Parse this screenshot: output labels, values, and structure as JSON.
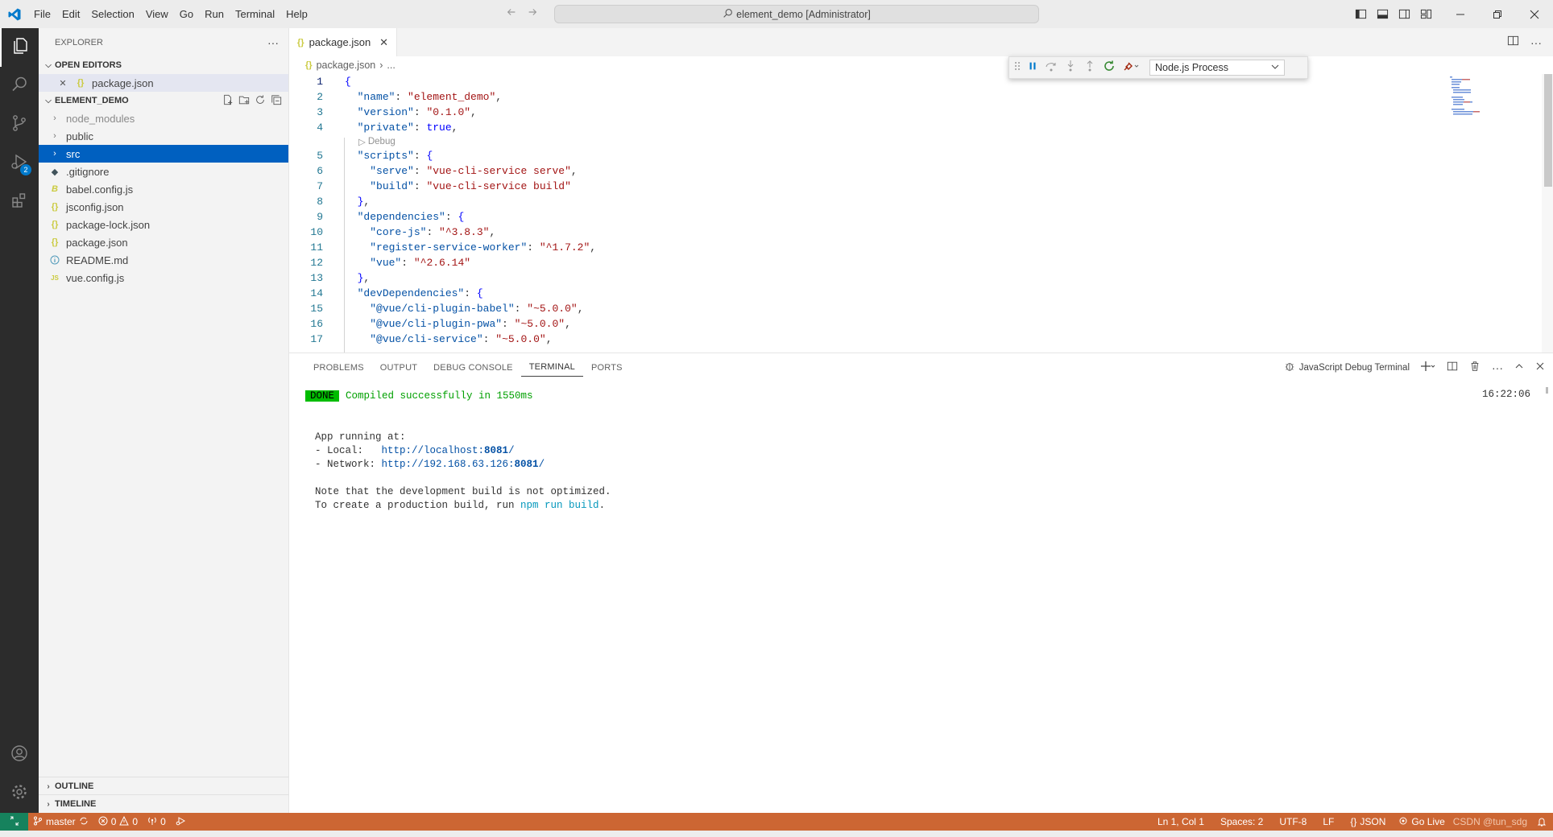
{
  "titlebar": {
    "menus": [
      "File",
      "Edit",
      "Selection",
      "View",
      "Go",
      "Run",
      "Terminal",
      "Help"
    ],
    "search_text": "element_demo [Administrator]"
  },
  "activity": {
    "debug_badge": "2"
  },
  "sidebar": {
    "header": "EXPLORER",
    "open_editors_title": "OPEN EDITORS",
    "open_editor_file": "package.json",
    "project_title": "ELEMENT_DEMO",
    "folders": [
      "node_modules",
      "public",
      "src"
    ],
    "files": [
      {
        "name": ".gitignore",
        "icon": "git-icon"
      },
      {
        "name": "babel.config.js",
        "icon": "babel-icon"
      },
      {
        "name": "jsconfig.json",
        "icon": "json-icon"
      },
      {
        "name": "package-lock.json",
        "icon": "json-icon"
      },
      {
        "name": "package.json",
        "icon": "json-icon"
      },
      {
        "name": "README.md",
        "icon": "info-icon"
      },
      {
        "name": "vue.config.js",
        "icon": "js-icon"
      }
    ],
    "outline": "OUTLINE",
    "timeline": "TIMELINE"
  },
  "editor": {
    "tab_label": "package.json",
    "breadcrumb_file": "package.json",
    "breadcrumb_more": "...",
    "codelens": "Debug",
    "lines": [
      "1",
      "2",
      "3",
      "4",
      "5",
      "6",
      "7",
      "8",
      "9",
      "10",
      "11",
      "12",
      "13",
      "14",
      "15",
      "16",
      "17"
    ]
  },
  "debug_toolbar": {
    "config": "Node.js Process"
  },
  "panel": {
    "tabs": [
      "PROBLEMS",
      "OUTPUT",
      "DEBUG CONSOLE",
      "TERMINAL",
      "PORTS"
    ],
    "active_tab": "TERMINAL",
    "terminal_name": "JavaScript Debug Terminal",
    "timestamp": "16:22:06",
    "done_badge": "DONE",
    "compiled": "Compiled successfully in 1550ms",
    "app_running": "App running at:",
    "local_label": "- Local:   ",
    "local_url_a": "http://localhost:",
    "local_port": "8081",
    "network_label": "- Network: ",
    "network_url_a": "http://192.168.63.126:",
    "network_port": "8081",
    "note1": "Note that the development build is not optimized.",
    "note2_a": "To create a production build, run ",
    "note2_cmd": "npm run build",
    "note2_end": "."
  },
  "statusbar": {
    "branch": "master",
    "errors": "0",
    "warnings": "0",
    "ports": "0",
    "position": "Ln 1, Col 1",
    "spaces": "Spaces: 2",
    "encoding": "UTF-8",
    "eol": "LF",
    "language": "JSON",
    "golive": "Go Live",
    "watermark": "CSDN @tun_sdg"
  },
  "colors": {
    "accent": "#007acc",
    "statusbar": "#cc6633",
    "selection": "#0060c0"
  }
}
